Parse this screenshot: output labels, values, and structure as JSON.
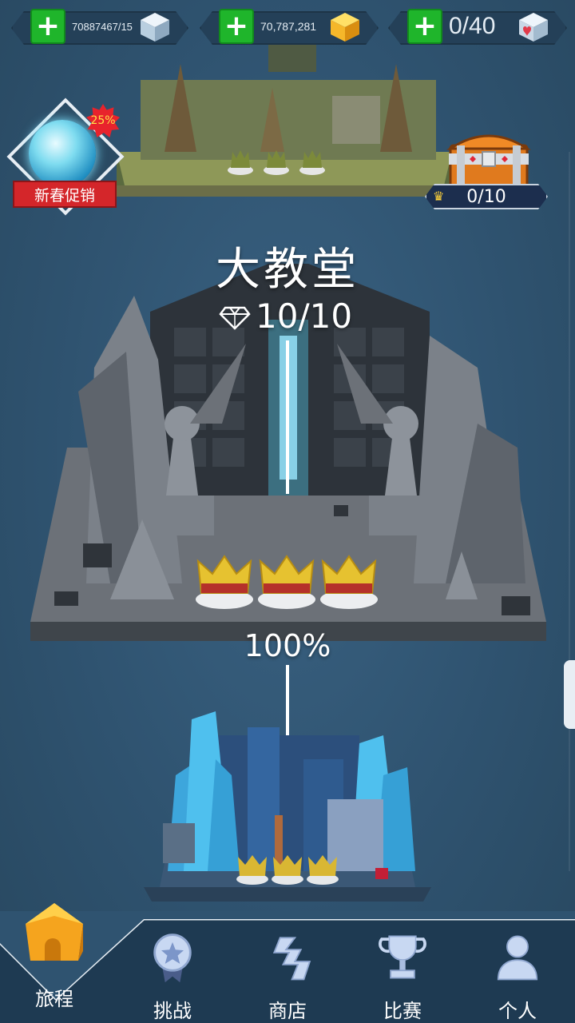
{
  "resources": [
    {
      "id": "ice-cubes",
      "value": "70887467/15",
      "icon": "ice-cube-icon"
    },
    {
      "id": "gold-cubes",
      "value": "70,787,281",
      "icon": "gold-cube-icon"
    },
    {
      "id": "hearts",
      "value": "0/40",
      "icon": "heart-cube-icon"
    }
  ],
  "promo": {
    "discount": "25%",
    "label": "新春促销"
  },
  "chest": {
    "counter": "0/10"
  },
  "level": {
    "title": "大教堂",
    "gems": "10/10",
    "percent": "100%"
  },
  "nav": [
    {
      "label": "旅程",
      "icon": "house-icon",
      "active": true
    },
    {
      "label": "挑战",
      "icon": "medal-icon",
      "active": false
    },
    {
      "label": "商店",
      "icon": "shop-icon",
      "active": false
    },
    {
      "label": "比赛",
      "icon": "trophy-icon",
      "active": false
    },
    {
      "label": "个人",
      "icon": "person-icon",
      "active": false
    }
  ],
  "colors": {
    "background": "#2f5370",
    "plus": "#1fb52b",
    "promo_red": "#d4262a",
    "gold": "#f5b72a"
  }
}
